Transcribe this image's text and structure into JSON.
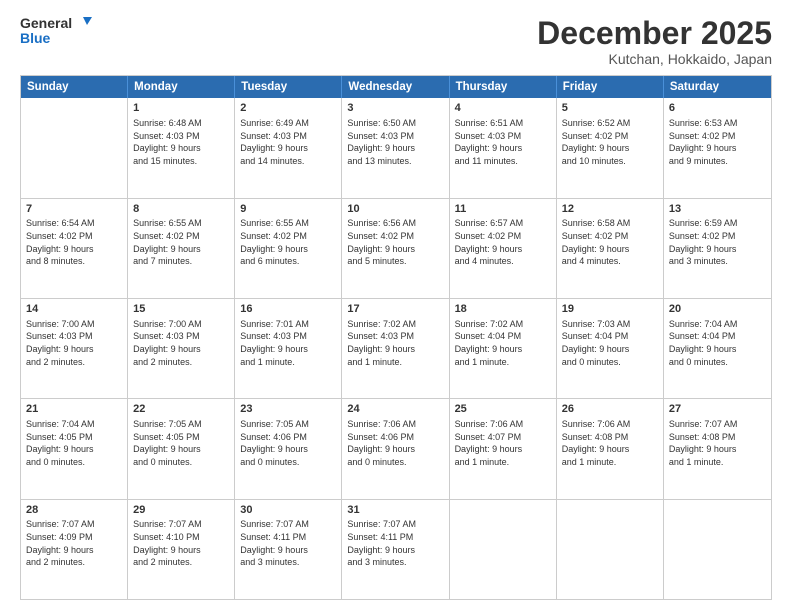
{
  "logo": {
    "line1": "General",
    "line2": "Blue"
  },
  "header": {
    "title": "December 2025",
    "subtitle": "Kutchan, Hokkaido, Japan"
  },
  "days": [
    "Sunday",
    "Monday",
    "Tuesday",
    "Wednesday",
    "Thursday",
    "Friday",
    "Saturday"
  ],
  "weeks": [
    [
      {
        "day": "",
        "info": ""
      },
      {
        "day": "1",
        "info": "Sunrise: 6:48 AM\nSunset: 4:03 PM\nDaylight: 9 hours\nand 15 minutes."
      },
      {
        "day": "2",
        "info": "Sunrise: 6:49 AM\nSunset: 4:03 PM\nDaylight: 9 hours\nand 14 minutes."
      },
      {
        "day": "3",
        "info": "Sunrise: 6:50 AM\nSunset: 4:03 PM\nDaylight: 9 hours\nand 13 minutes."
      },
      {
        "day": "4",
        "info": "Sunrise: 6:51 AM\nSunset: 4:03 PM\nDaylight: 9 hours\nand 11 minutes."
      },
      {
        "day": "5",
        "info": "Sunrise: 6:52 AM\nSunset: 4:02 PM\nDaylight: 9 hours\nand 10 minutes."
      },
      {
        "day": "6",
        "info": "Sunrise: 6:53 AM\nSunset: 4:02 PM\nDaylight: 9 hours\nand 9 minutes."
      }
    ],
    [
      {
        "day": "7",
        "info": "Sunrise: 6:54 AM\nSunset: 4:02 PM\nDaylight: 9 hours\nand 8 minutes."
      },
      {
        "day": "8",
        "info": "Sunrise: 6:55 AM\nSunset: 4:02 PM\nDaylight: 9 hours\nand 7 minutes."
      },
      {
        "day": "9",
        "info": "Sunrise: 6:55 AM\nSunset: 4:02 PM\nDaylight: 9 hours\nand 6 minutes."
      },
      {
        "day": "10",
        "info": "Sunrise: 6:56 AM\nSunset: 4:02 PM\nDaylight: 9 hours\nand 5 minutes."
      },
      {
        "day": "11",
        "info": "Sunrise: 6:57 AM\nSunset: 4:02 PM\nDaylight: 9 hours\nand 4 minutes."
      },
      {
        "day": "12",
        "info": "Sunrise: 6:58 AM\nSunset: 4:02 PM\nDaylight: 9 hours\nand 4 minutes."
      },
      {
        "day": "13",
        "info": "Sunrise: 6:59 AM\nSunset: 4:02 PM\nDaylight: 9 hours\nand 3 minutes."
      }
    ],
    [
      {
        "day": "14",
        "info": "Sunrise: 7:00 AM\nSunset: 4:03 PM\nDaylight: 9 hours\nand 2 minutes."
      },
      {
        "day": "15",
        "info": "Sunrise: 7:00 AM\nSunset: 4:03 PM\nDaylight: 9 hours\nand 2 minutes."
      },
      {
        "day": "16",
        "info": "Sunrise: 7:01 AM\nSunset: 4:03 PM\nDaylight: 9 hours\nand 1 minute."
      },
      {
        "day": "17",
        "info": "Sunrise: 7:02 AM\nSunset: 4:03 PM\nDaylight: 9 hours\nand 1 minute."
      },
      {
        "day": "18",
        "info": "Sunrise: 7:02 AM\nSunset: 4:04 PM\nDaylight: 9 hours\nand 1 minute."
      },
      {
        "day": "19",
        "info": "Sunrise: 7:03 AM\nSunset: 4:04 PM\nDaylight: 9 hours\nand 0 minutes."
      },
      {
        "day": "20",
        "info": "Sunrise: 7:04 AM\nSunset: 4:04 PM\nDaylight: 9 hours\nand 0 minutes."
      }
    ],
    [
      {
        "day": "21",
        "info": "Sunrise: 7:04 AM\nSunset: 4:05 PM\nDaylight: 9 hours\nand 0 minutes."
      },
      {
        "day": "22",
        "info": "Sunrise: 7:05 AM\nSunset: 4:05 PM\nDaylight: 9 hours\nand 0 minutes."
      },
      {
        "day": "23",
        "info": "Sunrise: 7:05 AM\nSunset: 4:06 PM\nDaylight: 9 hours\nand 0 minutes."
      },
      {
        "day": "24",
        "info": "Sunrise: 7:06 AM\nSunset: 4:06 PM\nDaylight: 9 hours\nand 0 minutes."
      },
      {
        "day": "25",
        "info": "Sunrise: 7:06 AM\nSunset: 4:07 PM\nDaylight: 9 hours\nand 1 minute."
      },
      {
        "day": "26",
        "info": "Sunrise: 7:06 AM\nSunset: 4:08 PM\nDaylight: 9 hours\nand 1 minute."
      },
      {
        "day": "27",
        "info": "Sunrise: 7:07 AM\nSunset: 4:08 PM\nDaylight: 9 hours\nand 1 minute."
      }
    ],
    [
      {
        "day": "28",
        "info": "Sunrise: 7:07 AM\nSunset: 4:09 PM\nDaylight: 9 hours\nand 2 minutes."
      },
      {
        "day": "29",
        "info": "Sunrise: 7:07 AM\nSunset: 4:10 PM\nDaylight: 9 hours\nand 2 minutes."
      },
      {
        "day": "30",
        "info": "Sunrise: 7:07 AM\nSunset: 4:11 PM\nDaylight: 9 hours\nand 3 minutes."
      },
      {
        "day": "31",
        "info": "Sunrise: 7:07 AM\nSunset: 4:11 PM\nDaylight: 9 hours\nand 3 minutes."
      },
      {
        "day": "",
        "info": ""
      },
      {
        "day": "",
        "info": ""
      },
      {
        "day": "",
        "info": ""
      }
    ]
  ]
}
